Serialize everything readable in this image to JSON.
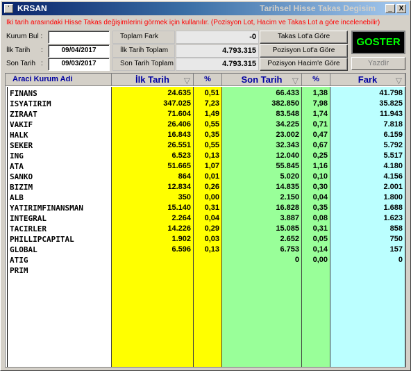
{
  "window": {
    "title_left": "KRSAN",
    "title_right": "Tarihsel Hisse Takas Degisim",
    "minimize_label": "_",
    "close_label": "X"
  },
  "info_text": "İki tarih arasındaki Hisse Takas değişimlerini görmek için kullanılır. (Pozisyon Lot, Hacim ve Takas Lot a göre incelenebilir)",
  "form": {
    "kurum_bul_label": "Kurum Bul :",
    "kurum_bul_value": "",
    "ilk_tarih_label": "İlk Tarih",
    "ilk_tarih_colon": ":",
    "ilk_tarih_value": "09/04/2017",
    "son_tarih_label": "Son Tarih",
    "son_tarih_colon": ":",
    "son_tarih_value": "09/03/2017"
  },
  "summary": {
    "toplam_fark_label": "Toplam Fark",
    "toplam_fark_value": "-0",
    "ilk_tarih_toplam_label": "İlk Tarih Toplam",
    "ilk_tarih_toplam_value": "4.793.315",
    "son_tarih_toplam_label": "Son Tarih Toplam",
    "son_tarih_toplam_value": "4.793.315"
  },
  "modes": {
    "takas_lot": "Takas Lot'a Göre",
    "pozisyon_lot": "Pozisyon Lot'a Göre",
    "pozisyon_hacim": "Pozisyon Hacim'e Göre"
  },
  "actions": {
    "goster": "GOSTER",
    "yazdir": "Yazdir"
  },
  "colors": {
    "ilk_bg": "#ffff00",
    "son_bg": "#99ff99",
    "fark_bg": "#bbffff",
    "goster_text": "#00ff00",
    "info_text": "#ff0000"
  },
  "table": {
    "headers": {
      "name": "Araci Kurum Adi",
      "ilk": "İlk Tarih",
      "p1": "%",
      "son": "Son Tarih",
      "p2": "%",
      "fark": "Fark"
    },
    "rows": [
      {
        "name": "FINANS",
        "ilk": "24.635",
        "p1": "0,51",
        "son": "66.433",
        "p2": "1,38",
        "fark": "41.798"
      },
      {
        "name": "ISYATIRIM",
        "ilk": "347.025",
        "p1": "7,23",
        "son": "382.850",
        "p2": "7,98",
        "fark": "35.825"
      },
      {
        "name": "ZIRAAT",
        "ilk": "71.604",
        "p1": "1,49",
        "son": "83.548",
        "p2": "1,74",
        "fark": "11.943"
      },
      {
        "name": "VAKIF",
        "ilk": "26.406",
        "p1": "0,55",
        "son": "34.225",
        "p2": "0,71",
        "fark": "7.818"
      },
      {
        "name": "HALK",
        "ilk": "16.843",
        "p1": "0,35",
        "son": "23.002",
        "p2": "0,47",
        "fark": "6.159"
      },
      {
        "name": "SEKER",
        "ilk": "26.551",
        "p1": "0,55",
        "son": "32.343",
        "p2": "0,67",
        "fark": "5.792"
      },
      {
        "name": "ING",
        "ilk": "6.523",
        "p1": "0,13",
        "son": "12.040",
        "p2": "0,25",
        "fark": "5.517"
      },
      {
        "name": "ATA",
        "ilk": "51.665",
        "p1": "1,07",
        "son": "55.845",
        "p2": "1,16",
        "fark": "4.180"
      },
      {
        "name": "SANKO",
        "ilk": "864",
        "p1": "0,01",
        "son": "5.020",
        "p2": "0,10",
        "fark": "4.156"
      },
      {
        "name": "BIZIM",
        "ilk": "12.834",
        "p1": "0,26",
        "son": "14.835",
        "p2": "0,30",
        "fark": "2.001"
      },
      {
        "name": "ALB",
        "ilk": "350",
        "p1": "0,00",
        "son": "2.150",
        "p2": "0,04",
        "fark": "1.800"
      },
      {
        "name": "YATIRIMFINANSMAN",
        "ilk": "15.140",
        "p1": "0,31",
        "son": "16.828",
        "p2": "0,35",
        "fark": "1.688"
      },
      {
        "name": "INTEGRAL",
        "ilk": "2.264",
        "p1": "0,04",
        "son": "3.887",
        "p2": "0,08",
        "fark": "1.623"
      },
      {
        "name": "TACIRLER",
        "ilk": "14.226",
        "p1": "0,29",
        "son": "15.085",
        "p2": "0,31",
        "fark": "858"
      },
      {
        "name": "PHILLIPCAPITAL",
        "ilk": "1.902",
        "p1": "0,03",
        "son": "2.652",
        "p2": "0,05",
        "fark": "750"
      },
      {
        "name": "GLOBAL",
        "ilk": "6.596",
        "p1": "0,13",
        "son": "6.753",
        "p2": "0,14",
        "fark": "157"
      },
      {
        "name": "ATIG",
        "ilk": "",
        "p1": "",
        "son": "0",
        "p2": "0,00",
        "fark": "0"
      },
      {
        "name": "PRIM",
        "ilk": "",
        "p1": "",
        "son": "",
        "p2": "",
        "fark": ""
      }
    ]
  }
}
